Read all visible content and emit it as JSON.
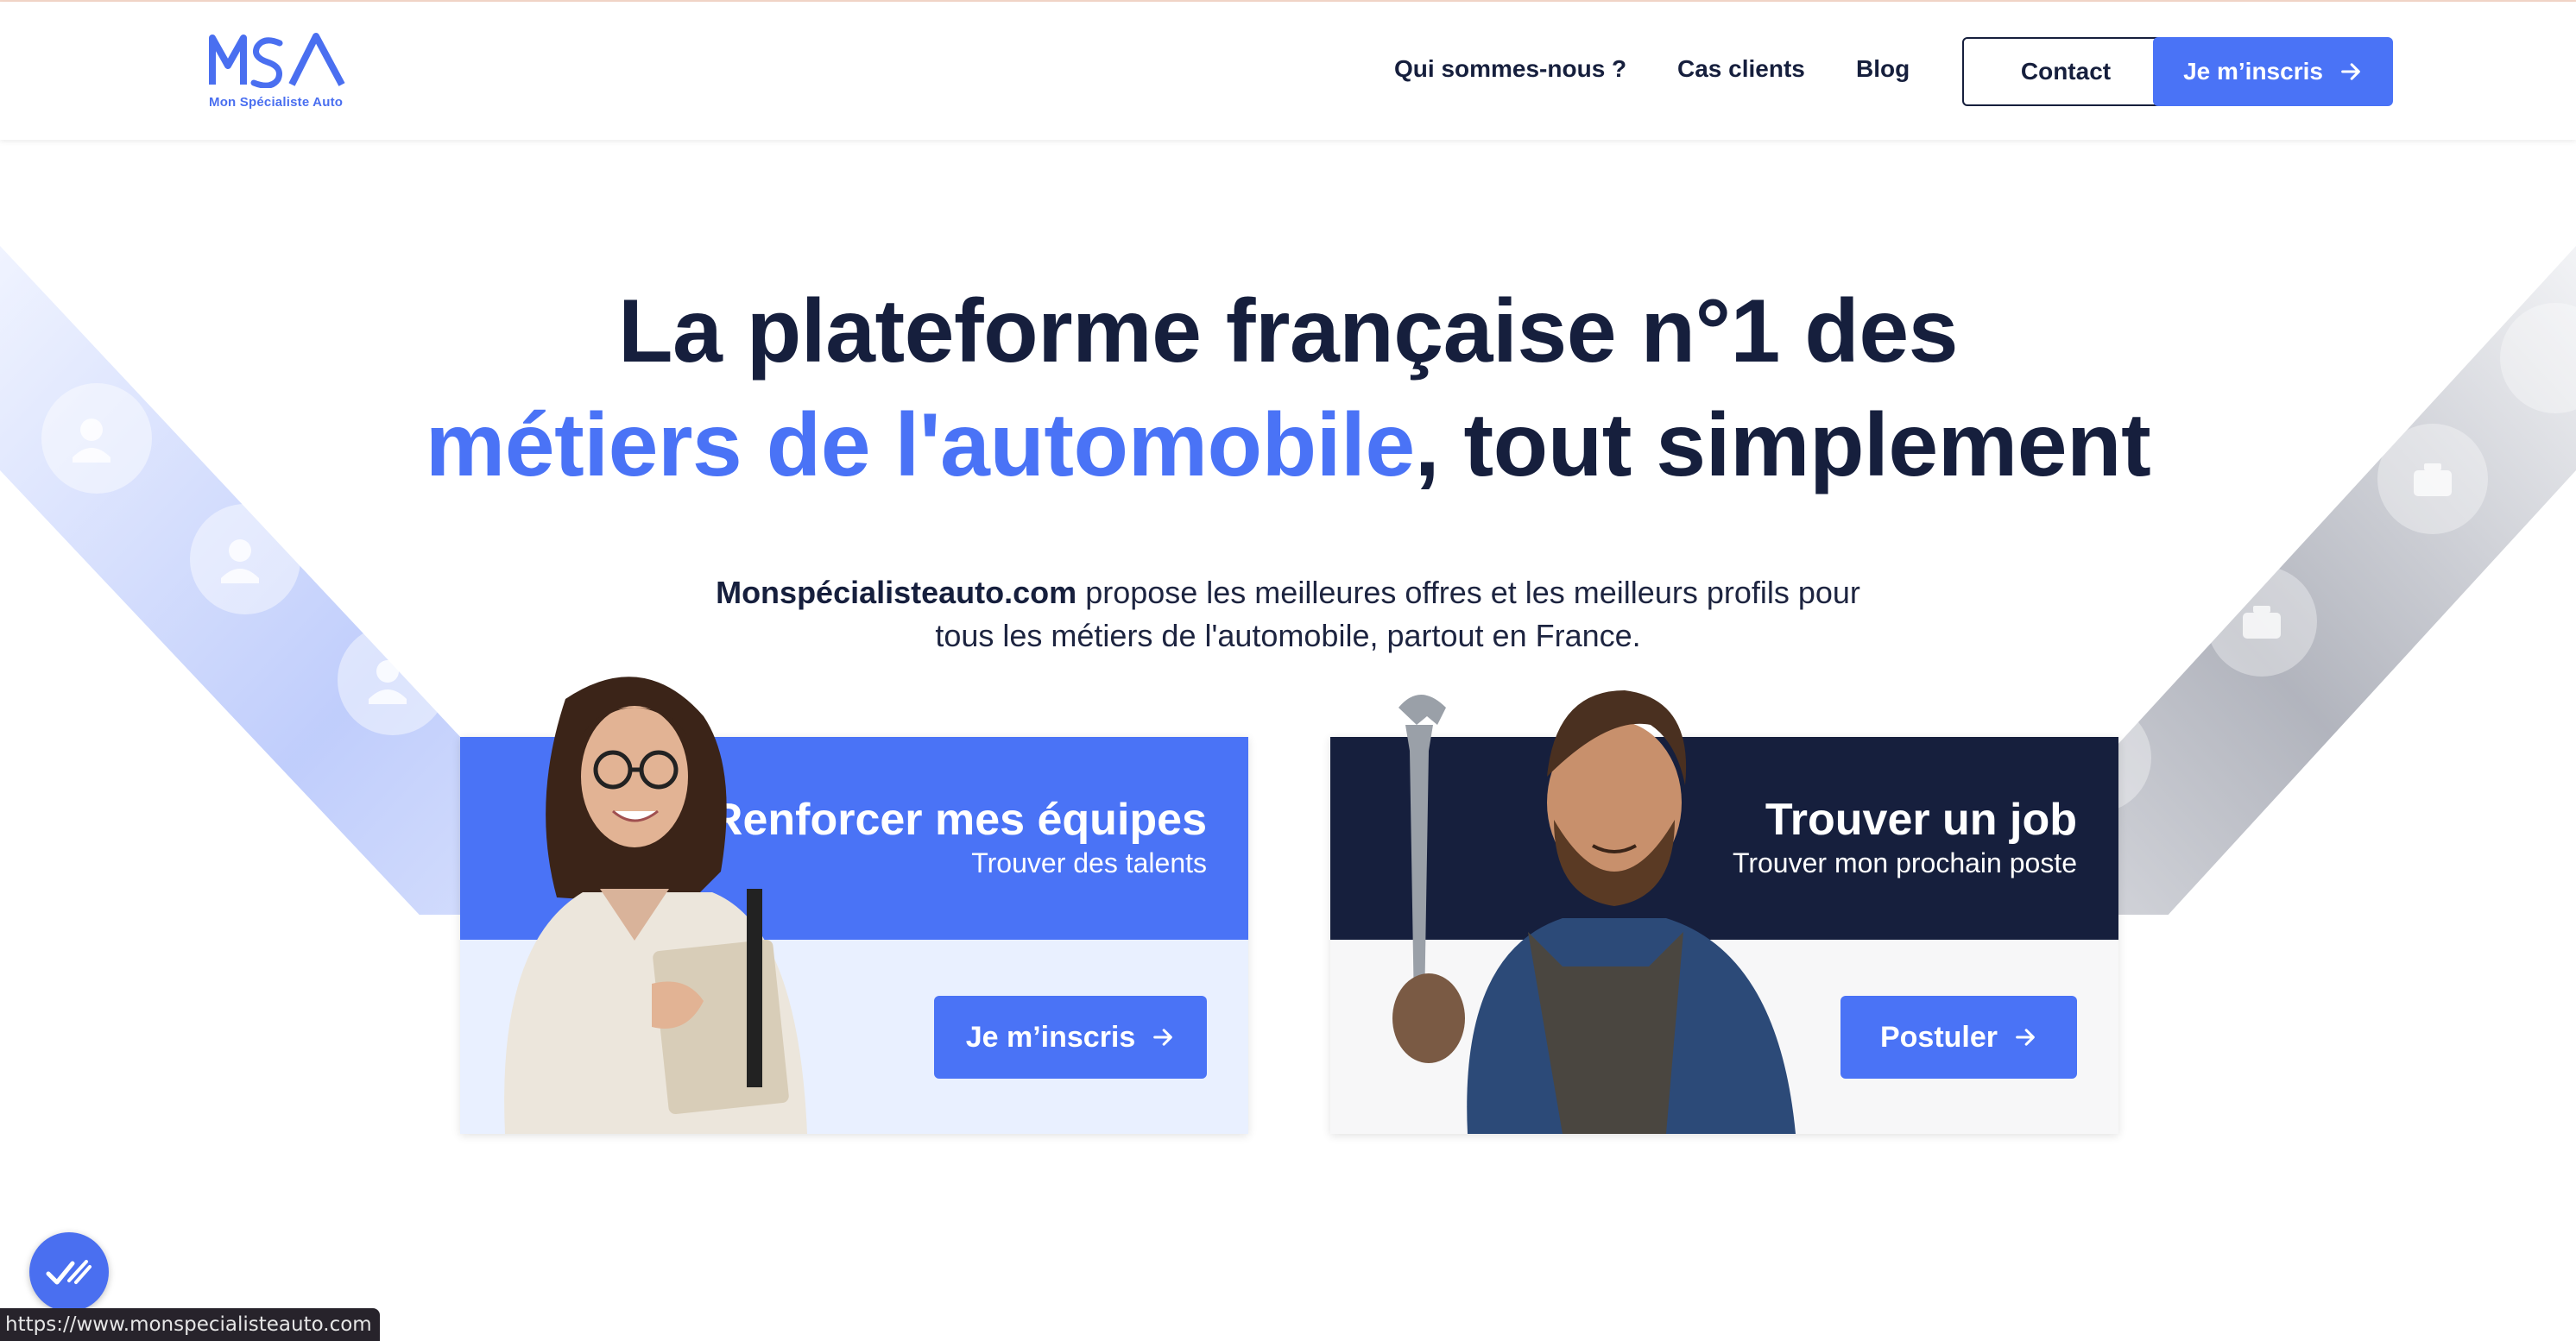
{
  "logo": {
    "letters": "MSA",
    "tagline": "Mon Spécialiste Auto"
  },
  "nav": {
    "links": [
      "Qui sommes-nous ?",
      "Cas clients",
      "Blog"
    ],
    "contact_label": "Contact",
    "signup_label": "Je m’inscris"
  },
  "hero": {
    "title_line1": "La plateforme française n°1 des",
    "title_accent": "métiers de l'automobile",
    "title_rest": ", tout simplement",
    "intro_bold": "Monspécialisteauto.com",
    "intro_text": " propose les meilleures offres et les meilleurs profils pour tous les métiers de l'automobile, partout en France."
  },
  "cards": [
    {
      "title": "Renforcer mes équipes",
      "subtitle": "Trouver des talents",
      "button": "Je m’inscris"
    },
    {
      "title": "Trouver un job",
      "subtitle": "Trouver mon prochain poste",
      "button": "Postuler"
    }
  ],
  "status_bar": {
    "url": "https://www.monspecialisteauto.com"
  },
  "colors": {
    "accent": "#4a73f6",
    "navy": "#161f3d",
    "light_blue": "#e9f0ff",
    "light_gray": "#f7f7f8"
  },
  "icons": [
    "add-user-icon",
    "briefcase-icon",
    "arrow-right-icon",
    "chat-icon"
  ]
}
